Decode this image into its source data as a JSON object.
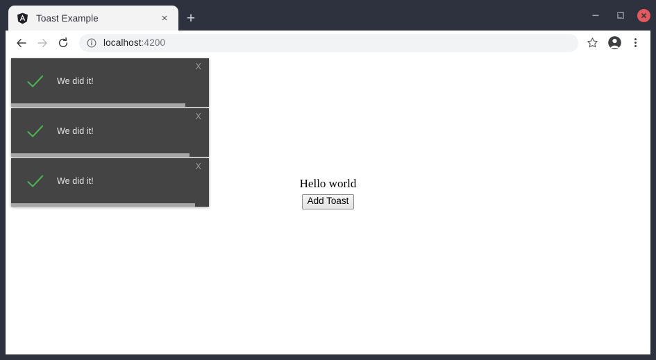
{
  "browser": {
    "tab": {
      "title": "Toast Example",
      "favicon_name": "angular-logo-icon",
      "close_label": "×"
    },
    "new_tab_label": "+",
    "window_controls": {
      "minimize_name": "minimize-icon",
      "maximize_name": "maximize-restore-icon",
      "close_name": "close-window-icon"
    },
    "toolbar": {
      "back_name": "back-arrow-icon",
      "forward_name": "forward-arrow-icon",
      "reload_name": "reload-icon",
      "site_info_name": "site-info-icon",
      "url_host": "localhost",
      "url_port": ":4200",
      "bookmark_name": "star-icon",
      "profile_name": "profile-avatar-icon",
      "menu_name": "three-dot-menu-icon"
    }
  },
  "page": {
    "heading": "Hello world",
    "add_toast_label": "Add Toast",
    "toasts": [
      {
        "message": "We did it!",
        "close_label": "X",
        "icon_name": "check-icon",
        "progress_percent": 88
      },
      {
        "message": "We did it!",
        "close_label": "X",
        "icon_name": "check-icon",
        "progress_percent": 90
      },
      {
        "message": "We did it!",
        "close_label": "X",
        "icon_name": "check-icon",
        "progress_percent": 93
      }
    ]
  },
  "colors": {
    "window_frame": "#2d323e",
    "toast_background": "#444444",
    "toast_text": "#e6e6e6",
    "check_green": "#4caf50",
    "progress_fill": "#a6a6a6",
    "close_button_red": "#e3595e"
  }
}
